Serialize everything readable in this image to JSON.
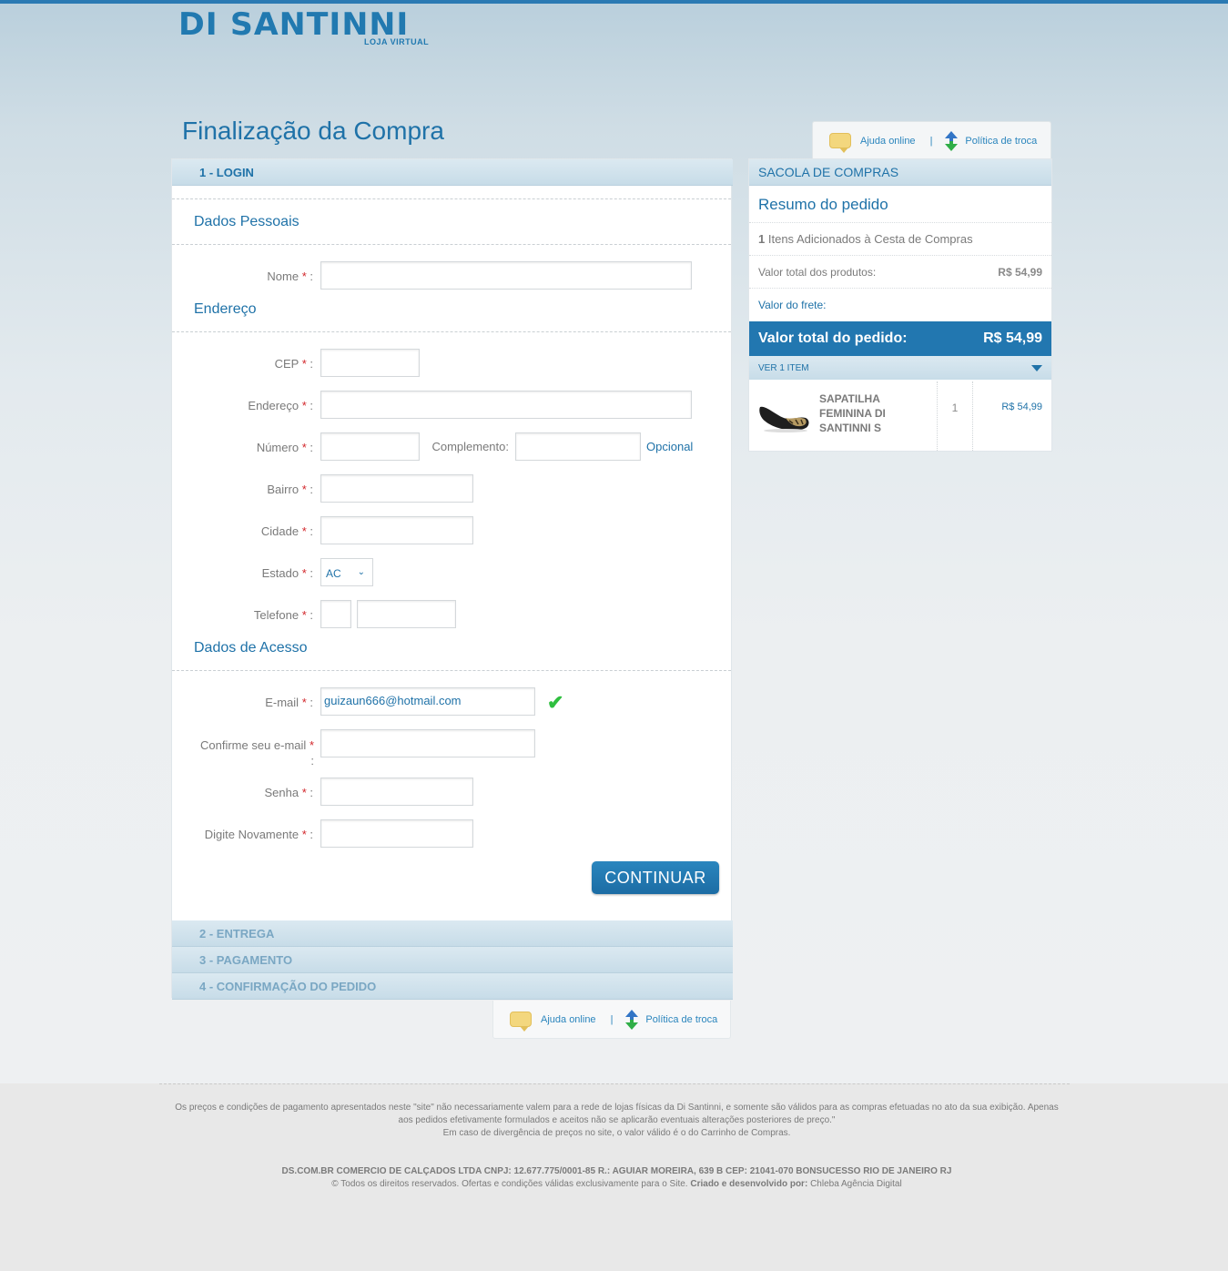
{
  "header": {
    "logo_text": "DI SANTINNI",
    "logo_sub": "LOJA VIRTUAL",
    "page_title": "Finalização da Compra"
  },
  "help": {
    "online": "Ajuda online",
    "separator": "|",
    "policy": "Política de troca"
  },
  "steps": {
    "login": "1 - LOGIN",
    "entrega": "2 - ENTREGA",
    "pagamento": "3 - PAGAMENTO",
    "confirmacao": "4 - CONFIRMAÇÃO DO PEDIDO"
  },
  "form": {
    "sec_personal": "Dados Pessoais",
    "sec_address": "Endereço",
    "sec_access": "Dados de Acesso",
    "required_mark": "*",
    "colon": ":",
    "nome_label": "Nome",
    "cep_label": "CEP",
    "endereco_label": "Endereço",
    "numero_label": "Número",
    "complemento_label": "Complemento:",
    "opcional": "Opcional",
    "bairro_label": "Bairro",
    "cidade_label": "Cidade",
    "estado_label": "Estado",
    "estado_value": "AC",
    "telefone_label": "Telefone",
    "email_label": "E-mail",
    "email_value": "guizaun666@hotmail.com",
    "confirm_email_label": "Confirme seu e-mail",
    "senha_label": "Senha",
    "digite_label": "Digite Novamente",
    "continue_button": "CONTINUAR"
  },
  "cart": {
    "title": "SACOLA DE COMPRAS",
    "summary_title": "Resumo do pedido",
    "items_count": "1",
    "items_text": "Itens Adicionados à Cesta de Compras",
    "products_total_label": "Valor total dos produtos:",
    "products_total_value": "R$ 54,99",
    "shipping_label": "Valor do frete:",
    "order_total_label": "Valor total do pedido:",
    "order_total_value": "R$ 54,99",
    "ver_items": "VER 1 ITEM",
    "item": {
      "name": "SAPATILHA FEMININA DI SANTINNI S",
      "qty": "1",
      "price": "R$ 54,99"
    }
  },
  "footer": {
    "disclaimer_1": "Os preços e condições de pagamento apresentados neste \"site\" não necessariamente valem para a rede de lojas físicas da Di Santinni, e somente são válidos para as compras efetuadas no ato da sua exibição. Apenas aos pedidos efetivamente formulados e aceitos não se aplicarão eventuais alterações posteriores de preço.\"",
    "disclaimer_2": "Em caso de divergência de preços no site, o valor válido é o do Carrinho de Compras.",
    "company": "DS.COM.BR COMERCIO DE CALÇADOS LTDA CNPJ: 12.677.775/0001-85 R.: AGUIAR MOREIRA, 639 B CEP: 21041-070 BONSUCESSO RIO DE JANEIRO RJ",
    "rights": "© Todos os direitos reservados. Ofertas e condições válidas exclusivamente para o Site.",
    "created_by_label": "Criado e desenvolvido por:",
    "agency": "Chleba Agência Digital"
  }
}
